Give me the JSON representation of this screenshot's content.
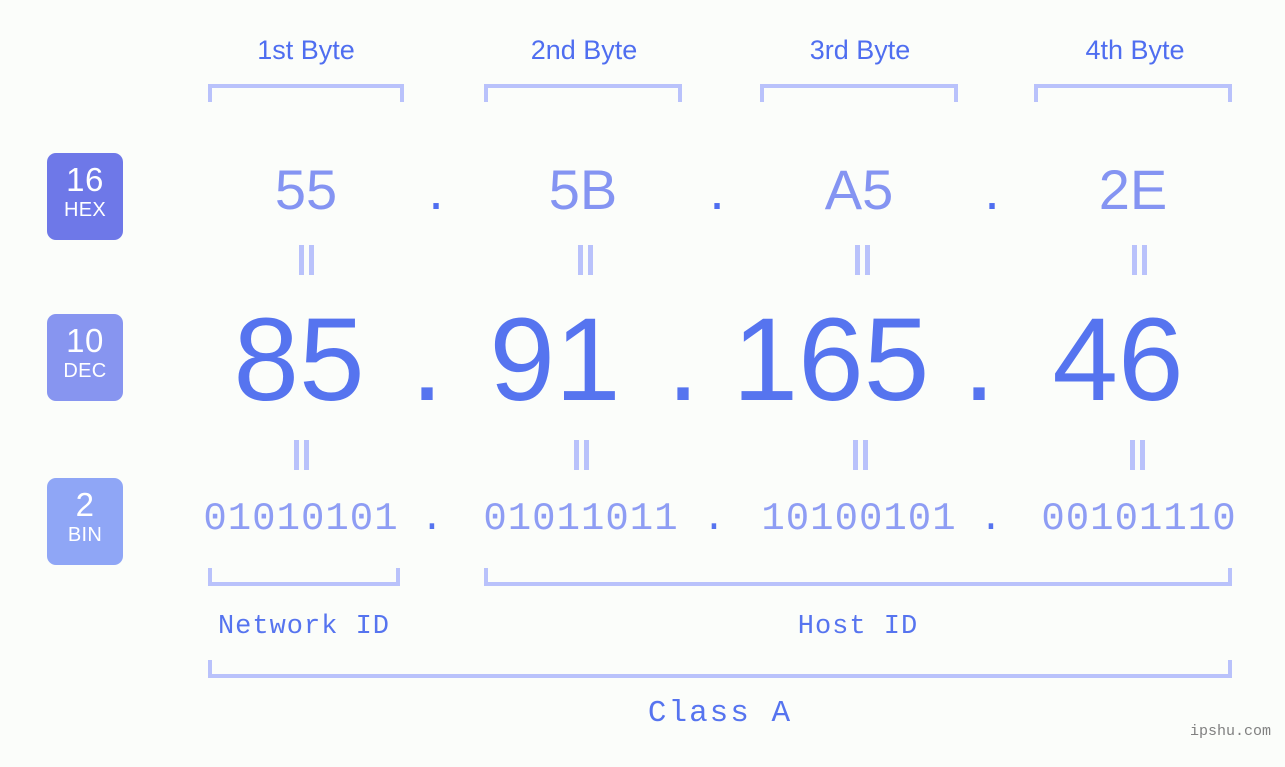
{
  "page": {
    "background_color": "#fbfdfa",
    "accent_color": "#5674ef",
    "light_accent_color": "#b9c2fb",
    "watermark": "ipshu.com"
  },
  "byte_headers": [
    {
      "label": "1st Byte"
    },
    {
      "label": "2nd Byte"
    },
    {
      "label": "3rd Byte"
    },
    {
      "label": "4th Byte"
    }
  ],
  "radix_badges": [
    {
      "number": "16",
      "name": "HEX",
      "color": "#6e78e8"
    },
    {
      "number": "10",
      "name": "DEC",
      "color": "#8795f0"
    },
    {
      "number": "2",
      "name": "BIN",
      "color": "#8fa6f6"
    }
  ],
  "rows": {
    "hex": {
      "radix": "16",
      "radix_name": "HEX",
      "values": [
        "55",
        "5B",
        "A5",
        "2E"
      ],
      "separator": "."
    },
    "dec": {
      "radix": "10",
      "radix_name": "DEC",
      "values": [
        "85",
        "91",
        "165",
        "46"
      ],
      "separator": "."
    },
    "bin": {
      "radix": "2",
      "radix_name": "BIN",
      "values": [
        "01010101",
        "01011011",
        "10100101",
        "00101110"
      ],
      "separator": "."
    }
  },
  "ip_address": {
    "hex": "55.5B.A5.2E",
    "dec": "85.91.165.46",
    "bin": "01010101.01011011.10100101.00101110"
  },
  "partitions": {
    "network_id_label": "Network ID",
    "host_id_label": "Host ID"
  },
  "class": {
    "label": "Class A"
  }
}
